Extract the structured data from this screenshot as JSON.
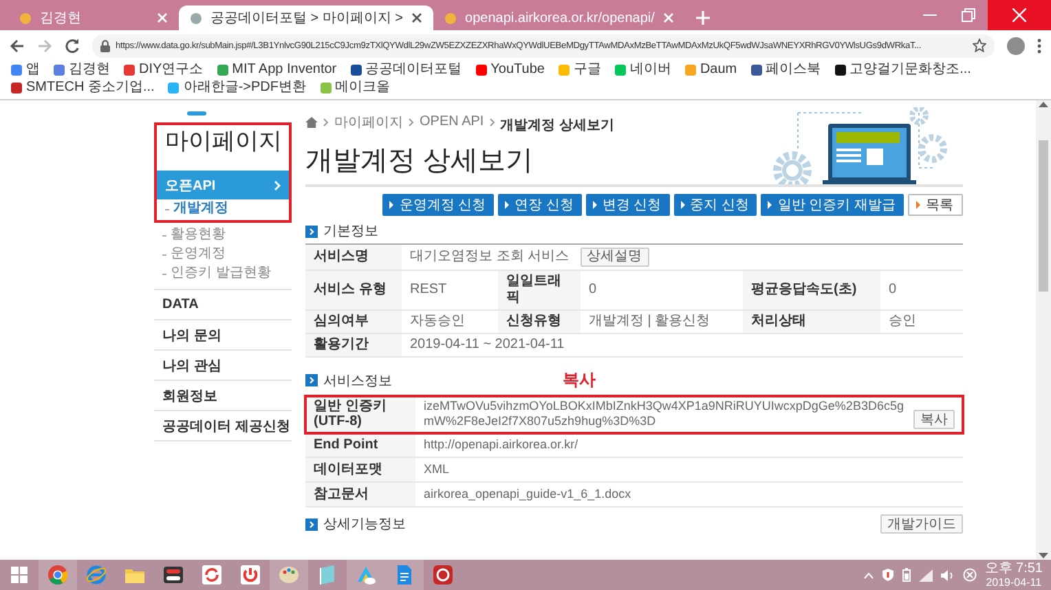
{
  "browser": {
    "tabs": [
      {
        "title": "김경현",
        "selected": false
      },
      {
        "title": "공공데이터포털 > 마이페이지 >",
        "selected": true
      },
      {
        "title": "openapi.airkorea.or.kr/openapi/",
        "selected": false
      }
    ],
    "url": "https://www.data.go.kr/subMain.jsp#/L3B1YnlvcG90L215cC9Jcm9zTXlQYWdlL29wZW5EZXZEZXRhaWxQYWdlUEBeMDgyTTAwMDAxMzBeTTAwMDAxMzUkQF5wdWJsaWNEYXRhRGV0YWlsUGs9dWRkaT...",
    "bookmarks": [
      {
        "label": "앱",
        "color": "#4285f4"
      },
      {
        "label": "김경현",
        "color": "#5b7fe0"
      },
      {
        "label": "DIY연구소",
        "color": "#e53935"
      },
      {
        "label": "MIT App Inventor",
        "color": "#34a853"
      },
      {
        "label": "공공데이터포털",
        "color": "#1a4c9c"
      },
      {
        "label": "YouTube",
        "color": "#ff0000"
      },
      {
        "label": "구글",
        "color": "#fbbc05"
      },
      {
        "label": "네이버",
        "color": "#03c75a"
      },
      {
        "label": "Daum",
        "color": "#f5a623"
      },
      {
        "label": "페이스북",
        "color": "#3b5998"
      },
      {
        "label": "고양걸기문화창조...",
        "color": "#111111"
      },
      {
        "label": "SMTECH 중소기업...",
        "color": "#c62828"
      },
      {
        "label": "아래한글->PDF변환",
        "color": "#29b6f6"
      },
      {
        "label": "메이크올",
        "color": "#8bc34a"
      }
    ]
  },
  "sidebar": {
    "title": "마이페이지",
    "highlighted": true,
    "items": [
      {
        "label": "오픈API",
        "selected": true,
        "children": [
          {
            "label": "개발계정",
            "selected": true
          },
          {
            "label": "활용현황",
            "selected": false
          },
          {
            "label": "운영계정",
            "selected": false
          },
          {
            "label": "인증키 발급현황",
            "selected": false
          }
        ]
      },
      {
        "label": "DATA",
        "selected": false
      },
      {
        "label": "나의 문의",
        "selected": false
      },
      {
        "label": "나의 관심",
        "selected": false
      },
      {
        "label": "회원정보",
        "selected": false
      },
      {
        "label": "공공데이터 제공신청",
        "selected": false
      }
    ]
  },
  "main": {
    "breadcrumb": [
      "마이페이지",
      "OPEN API",
      "개발계정 상세보기"
    ],
    "title": "개발계정 상세보기",
    "buttons": [
      {
        "label": "운영계정 신청",
        "kind": "primary"
      },
      {
        "label": "연장 신청",
        "kind": "primary"
      },
      {
        "label": "변경 신청",
        "kind": "primary"
      },
      {
        "label": "중지 신청",
        "kind": "primary"
      },
      {
        "label": "일반 인증키 재발급",
        "kind": "primary"
      },
      {
        "label": "목록",
        "kind": "secondary"
      }
    ],
    "basic_info": {
      "heading": "기본정보",
      "rows": [
        [
          {
            "kind": "label",
            "text": "서비스명"
          },
          {
            "kind": "value",
            "text": "대기오염정보 조회 서비스",
            "button": "상세설명"
          }
        ],
        [
          {
            "kind": "label",
            "text": "서비스 유형"
          },
          {
            "kind": "value",
            "text": "REST"
          },
          {
            "kind": "label",
            "text": "일일트래픽"
          },
          {
            "kind": "value",
            "text": "0"
          },
          {
            "kind": "label",
            "text": "평균응답속도(초)"
          },
          {
            "kind": "value",
            "text": "0"
          }
        ],
        [
          {
            "kind": "label",
            "text": "심의여부"
          },
          {
            "kind": "value",
            "text": "자동승인"
          },
          {
            "kind": "label",
            "text": "신청유형"
          },
          {
            "kind": "value",
            "text": "개발계정 | 활용신청"
          },
          {
            "kind": "label",
            "text": "처리상태"
          },
          {
            "kind": "value",
            "text": "승인"
          }
        ],
        [
          {
            "kind": "label",
            "text": "활용기간"
          },
          {
            "kind": "value",
            "text": "2019-04-11 ~ 2021-04-11"
          }
        ]
      ]
    },
    "service_info": {
      "heading": "서비스정보",
      "annotation": "복사",
      "rows": [
        {
          "label": "일반 인증키 (UTF-8)",
          "value": "izeMTwOVu5vihzmOYoLBOKxIMbIZnkH3Qw4XP1a9NRiRUYUIwcxpDgGe%2B3D6c5gmW%2F8eJeI2f7X807u5zh9hug%3D%3D",
          "button": "복사",
          "highlighted": true
        },
        {
          "label": "End Point",
          "value": "http://openapi.airkorea.or.kr/",
          "highlighted": false
        },
        {
          "label": "데이터포맷",
          "value": "XML",
          "highlighted": false
        },
        {
          "label": "참고문서",
          "value": "airkorea_openapi_guide-v1_6_1.docx",
          "highlighted": false
        }
      ]
    },
    "detail_info": {
      "heading": "상세기능정보",
      "button": "개발가이드"
    }
  },
  "taskbar": {
    "time": "오후 7:51",
    "date": "2019-04-11"
  }
}
